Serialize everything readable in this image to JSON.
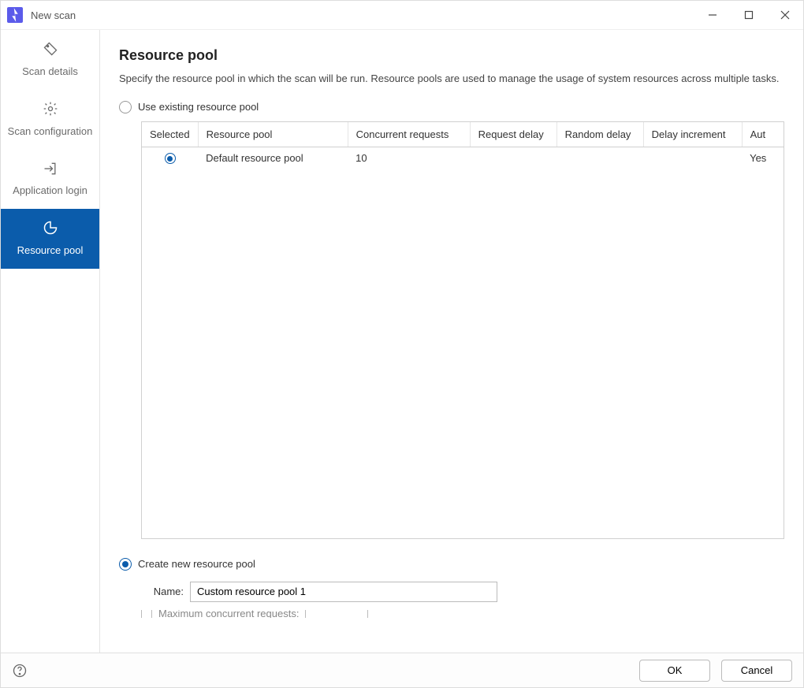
{
  "window": {
    "title": "New scan"
  },
  "sidebar": {
    "items": [
      {
        "label": "Scan details"
      },
      {
        "label": "Scan configuration"
      },
      {
        "label": "Application login"
      },
      {
        "label": "Resource pool"
      }
    ]
  },
  "page": {
    "heading": "Resource pool",
    "description": "Specify the resource pool in which the scan will be run. Resource pools are used to manage the usage of system resources across multiple tasks."
  },
  "options": {
    "use_existing_label": "Use existing resource pool",
    "create_new_label": "Create new resource pool"
  },
  "table": {
    "columns": {
      "selected": "Selected",
      "resource_pool": "Resource pool",
      "concurrent_requests": "Concurrent requests",
      "request_delay": "Request delay",
      "random_delay": "Random delay",
      "delay_increment": "Delay increment",
      "auto_throttle": "Aut"
    },
    "rows": [
      {
        "selected": true,
        "resource_pool": "Default resource pool",
        "concurrent_requests": "10",
        "request_delay": "",
        "random_delay": "",
        "delay_increment": "",
        "auto_throttle": "Yes"
      }
    ]
  },
  "form": {
    "name_label": "Name:",
    "name_value": "Custom resource pool 1",
    "max_concurrent_label": "Maximum concurrent requests:"
  },
  "footer": {
    "ok": "OK",
    "cancel": "Cancel"
  }
}
